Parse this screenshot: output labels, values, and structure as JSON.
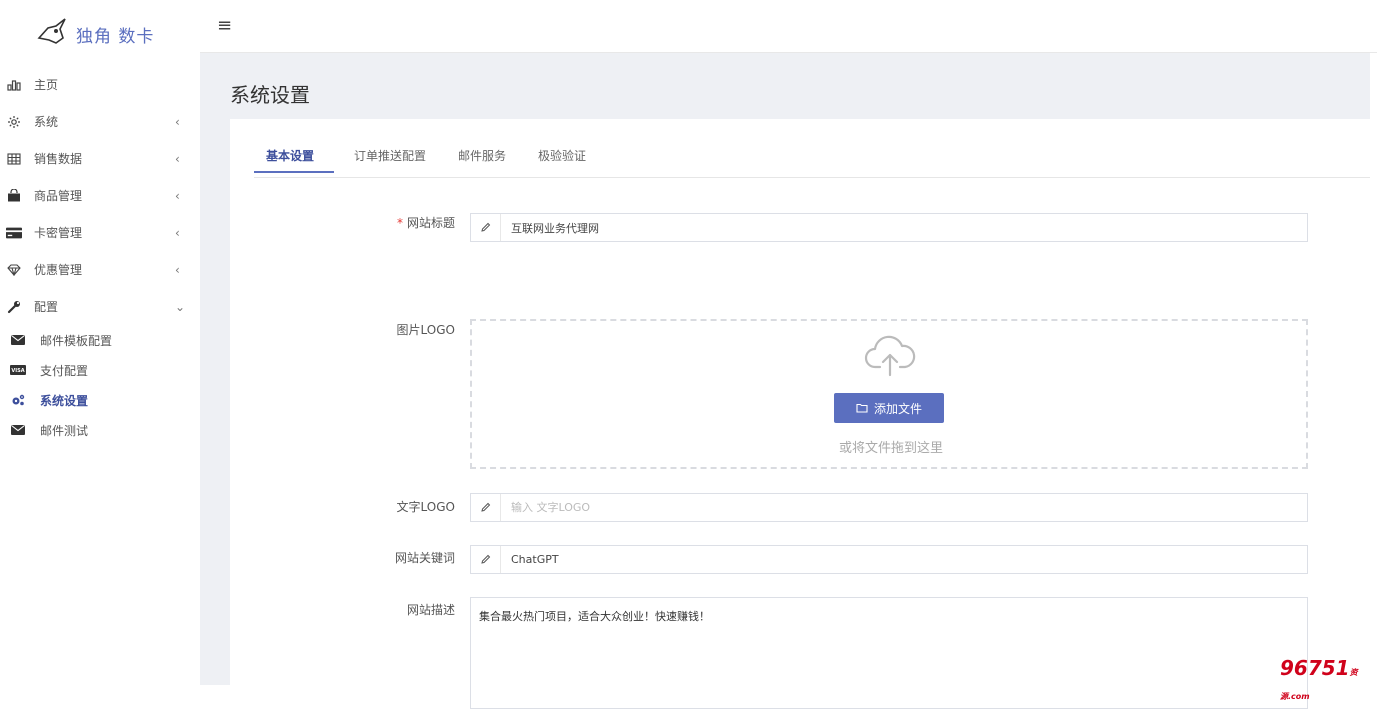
{
  "brand": {
    "name": "独角 数卡"
  },
  "sidebar": {
    "items": [
      {
        "label": "主页",
        "icon": "bar-chart-icon",
        "has_chevron": false
      },
      {
        "label": "系统",
        "icon": "gear-icon",
        "chevron": "‹"
      },
      {
        "label": "销售数据",
        "icon": "table-icon",
        "chevron": "‹"
      },
      {
        "label": "商品管理",
        "icon": "shopping-bag-icon",
        "chevron": "‹"
      },
      {
        "label": "卡密管理",
        "icon": "credit-card-icon",
        "chevron": "‹"
      },
      {
        "label": "优惠管理",
        "icon": "diamond-icon",
        "chevron": "‹"
      },
      {
        "label": "配置",
        "icon": "wrench-icon",
        "chevron": "⌄"
      }
    ],
    "sub_items": [
      {
        "label": "邮件模板配置",
        "icon": "envelope-icon"
      },
      {
        "label": "支付配置",
        "icon": "visa-icon"
      },
      {
        "label": "系统设置",
        "icon": "gears-icon",
        "active": true
      },
      {
        "label": "邮件测试",
        "icon": "envelope-icon"
      }
    ]
  },
  "topbar": {
    "menu_icon": "≡"
  },
  "page": {
    "title": "系统设置"
  },
  "tabs": [
    {
      "label": "基本设置",
      "active": true
    },
    {
      "label": "订单推送配置"
    },
    {
      "label": "邮件服务"
    },
    {
      "label": "极验验证"
    }
  ],
  "form": {
    "site_title": {
      "label": "网站标题",
      "required_mark": "*",
      "value": "互联网业务代理网"
    },
    "image_logo": {
      "label": "图片LOGO",
      "button": "添加文件",
      "hint": "或将文件拖到这里"
    },
    "text_logo": {
      "label": "文字LOGO",
      "value": "",
      "placeholder": "输入 文字LOGO"
    },
    "keywords": {
      "label": "网站关键词",
      "value": "ChatGPT"
    },
    "description": {
      "label": "网站描述",
      "value": "集合最火热门项目，适合大众创业！快速赚钱！"
    }
  },
  "watermark": {
    "text": "96751",
    "suffix": "资源.com"
  },
  "colors": {
    "accent": "#5b6fbf",
    "active_text": "#3d4f9c",
    "content_bg": "#eef0f4",
    "required": "#e53935"
  }
}
